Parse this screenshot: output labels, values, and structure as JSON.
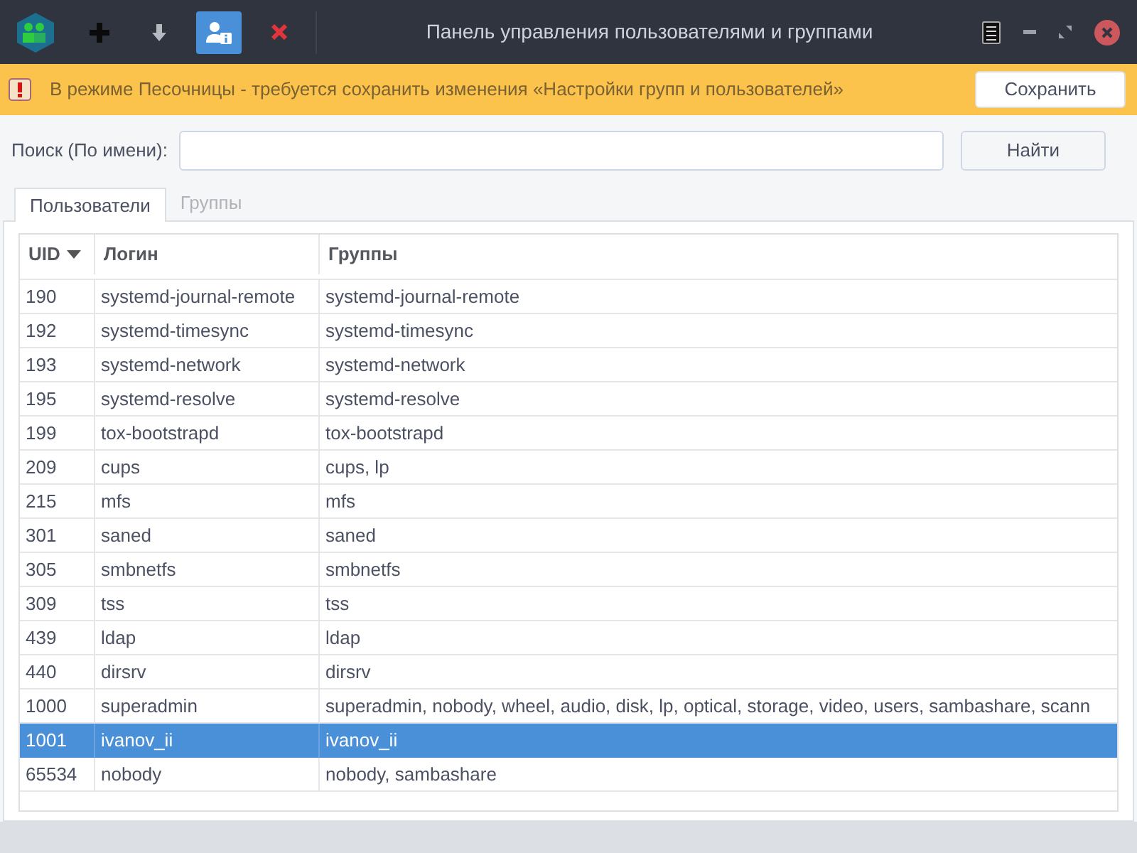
{
  "toolbar": [
    {
      "kind": "add",
      "selected": false
    },
    {
      "kind": "download",
      "selected": false
    },
    {
      "kind": "user-info",
      "selected": true
    },
    {
      "kind": "delete",
      "selected": false
    }
  ],
  "window": {
    "title": "Панель управления пользователями и группами"
  },
  "warning": {
    "text": "В режиме Песочницы - требуется сохранить изменения «Настройки групп и пользователей»",
    "button": "Сохранить"
  },
  "search": {
    "label": "Поиск (По имени):",
    "button": "Найти"
  },
  "tabs": [
    {
      "label": "Пользователи",
      "selected": true
    },
    {
      "label": "Группы",
      "selected": false
    }
  ],
  "table": {
    "columns": [
      {
        "label": "UID",
        "sorted": true
      },
      {
        "label": "Логин"
      },
      {
        "label": "Группы"
      }
    ],
    "rows": [
      {
        "cells": [
          "190",
          "systemd-journal-remote",
          "systemd-journal-remote"
        ],
        "selected": false
      },
      {
        "cells": [
          "192",
          "systemd-timesync",
          "systemd-timesync"
        ],
        "selected": false
      },
      {
        "cells": [
          "193",
          "systemd-network",
          "systemd-network"
        ],
        "selected": false
      },
      {
        "cells": [
          "195",
          "systemd-resolve",
          "systemd-resolve"
        ],
        "selected": false
      },
      {
        "cells": [
          "199",
          "tox-bootstrapd",
          "tox-bootstrapd"
        ],
        "selected": false
      },
      {
        "cells": [
          "209",
          "cups",
          "cups, lp"
        ],
        "selected": false
      },
      {
        "cells": [
          "215",
          "mfs",
          "mfs"
        ],
        "selected": false
      },
      {
        "cells": [
          "301",
          "saned",
          "saned"
        ],
        "selected": false
      },
      {
        "cells": [
          "305",
          "smbnetfs",
          "smbnetfs"
        ],
        "selected": false
      },
      {
        "cells": [
          "309",
          "tss",
          "tss"
        ],
        "selected": false
      },
      {
        "cells": [
          "439",
          "ldap",
          "ldap"
        ],
        "selected": false
      },
      {
        "cells": [
          "440",
          "dirsrv",
          "dirsrv"
        ],
        "selected": false
      },
      {
        "cells": [
          "1000",
          "superadmin",
          "superadmin, nobody, wheel, audio, disk, lp, optical, storage, video, users, sambashare, scann"
        ],
        "selected": false
      },
      {
        "cells": [
          "1001",
          "ivanov_ii",
          "ivanov_ii"
        ],
        "selected": true
      },
      {
        "cells": [
          "65534",
          "nobody",
          "nobody, sambashare"
        ],
        "selected": false
      }
    ]
  }
}
